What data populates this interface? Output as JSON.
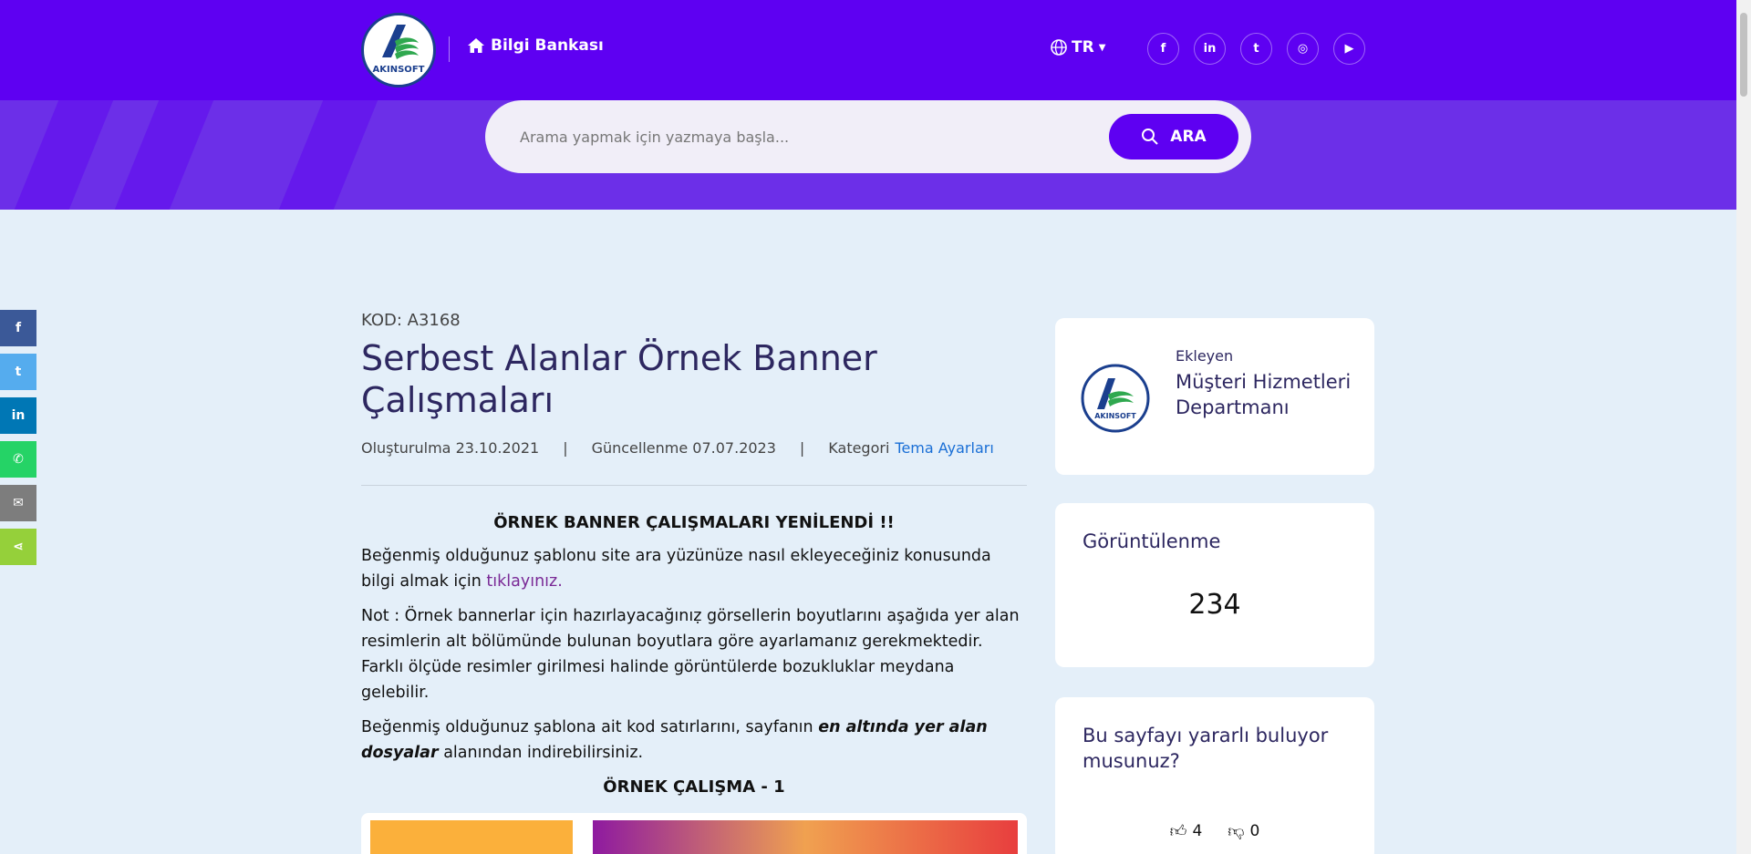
{
  "header": {
    "logo_text": "AKINSOFT",
    "home_label": "Bilgi Bankası",
    "language": "TR",
    "socials": [
      {
        "icon": "facebook-icon",
        "glyph": "f"
      },
      {
        "icon": "linkedin-icon",
        "glyph": "in"
      },
      {
        "icon": "twitter-icon",
        "glyph": "t"
      },
      {
        "icon": "instagram-icon",
        "glyph": "◎"
      },
      {
        "icon": "youtube-icon",
        "glyph": "▶"
      }
    ]
  },
  "search": {
    "placeholder": "Arama yapmak için yazmaya başla...",
    "button_label": "ARA"
  },
  "share_bar": [
    {
      "icon": "facebook-icon",
      "glyph": "f",
      "color": "#3b5998"
    },
    {
      "icon": "twitter-icon",
      "glyph": "t",
      "color": "#55acee"
    },
    {
      "icon": "linkedin-icon",
      "glyph": "in",
      "color": "#0077b5"
    },
    {
      "icon": "whatsapp-icon",
      "glyph": "✆",
      "color": "#25d366"
    },
    {
      "icon": "email-icon",
      "glyph": "✉",
      "color": "#7d7d7d"
    },
    {
      "icon": "share-icon",
      "glyph": "⋖",
      "color": "#95d03a"
    }
  ],
  "article": {
    "code": "KOD: A3168",
    "title": "Serbest Alanlar Örnek Banner Çalışmaları",
    "created_label": "Oluşturulma",
    "created_date": "23.10.2021",
    "updated_label": "Güncellenme",
    "updated_date": "07.07.2023",
    "category_label": "Kategori",
    "category_value": "Tema Ayarları",
    "heading": "ÖRNEK BANNER ÇALIŞMALARI YENİLENDİ !!",
    "p1_text": "Beğenmiş olduğunuz şablonu site ara yüzünüze nasıl ekleyeceğiniz konusunda bilgi almak için ",
    "p1_link": "tıklayınız.",
    "p2": "Not : Örnek bannerlar için hazırlayacağınıẓ görsellerin boyutlarını aşağıda yer alan resimlerin alt bölümünde bulunan boyutlara göre ayarlamanız gerekmektedir. Farklı ölçüde resimler girilmesi halinde görüntülerde bozukluklar meydana gelebilir.",
    "p3_text": "Beğenmiş olduğunuz şablona ait kod satırlarını, sayfanın ",
    "p3_bold": "en altında yer alan dosyalar",
    "p3_end": " alanından indirebilirsiniz.",
    "example_heading": "ÖRNEK ÇALIŞMA - 1"
  },
  "sidebar": {
    "author_label": "Ekleyen",
    "author_name": "Müşteri Hizmetleri Departmanı",
    "views_label": "Görüntülenme",
    "views_count": "234",
    "useful_question": "Bu sayfayı yararlı buluyor musunuz?",
    "likes": "4",
    "dislikes": "0"
  },
  "colors": {
    "brand_purple": "#5e00f2",
    "hero_purple": "#6c2fe8",
    "background": "#e4eff9",
    "title_color": "#2d2760",
    "link_blue": "#1a6fd6"
  }
}
